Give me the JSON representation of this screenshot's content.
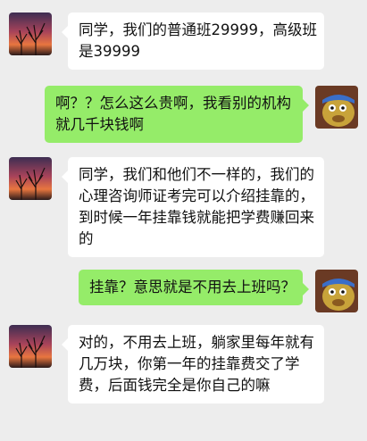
{
  "messages": [
    {
      "side": "in",
      "lines": [
        "同学，我们的普通班29999，高级班",
        "是39999"
      ]
    },
    {
      "side": "out",
      "lines": [
        "啊？？怎么这么贵啊，我看别的机构",
        "就几千块钱啊"
      ]
    },
    {
      "side": "in",
      "lines": [
        "同学，我们和他们不一样的，我们的",
        "心理咨询师证考完可以介绍挂靠的，",
        "到时候一年挂靠钱就能把学费赚回来",
        "的"
      ]
    },
    {
      "side": "out",
      "lines": [
        "挂靠？意思就是不用去上班吗？"
      ]
    },
    {
      "side": "in",
      "lines": [
        "对的，不用去上班，躺家里每年就有",
        "几万块，你第一年的挂靠费交了学",
        "费，后面钱完全是你自己的嘛"
      ]
    }
  ],
  "avatars": {
    "counselor": "sunset-tree-avatar",
    "student": "cartoon-character-avatar"
  },
  "colors": {
    "background": "#ededed",
    "incoming_bubble": "#ffffff",
    "outgoing_bubble": "#95ec69"
  }
}
